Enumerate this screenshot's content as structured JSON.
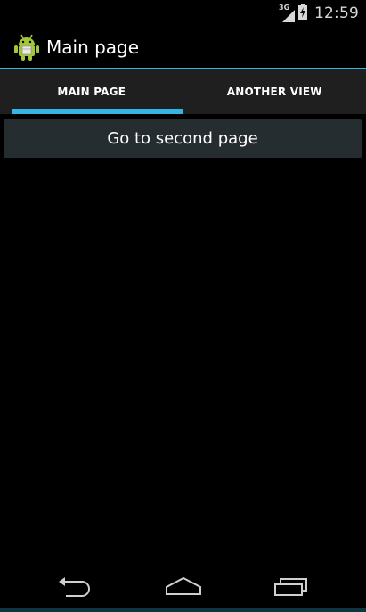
{
  "status_bar": {
    "network_label": "3G",
    "time": "12:59",
    "icons": [
      "signal-icon",
      "battery-icon"
    ]
  },
  "action_bar": {
    "title": "Main page",
    "icon": "android-icon"
  },
  "tabs": [
    {
      "label": "MAIN PAGE",
      "selected": true
    },
    {
      "label": "ANOTHER VIEW",
      "selected": false
    }
  ],
  "content": {
    "button_label": "Go to second page"
  },
  "nav_bar": {
    "icons": [
      "back-icon",
      "home-icon",
      "recents-icon"
    ]
  },
  "colors": {
    "accent": "#33b5e5",
    "tab_bar_bg": "#1f1f1f",
    "button_bg": "#262d31",
    "background": "#000000"
  }
}
